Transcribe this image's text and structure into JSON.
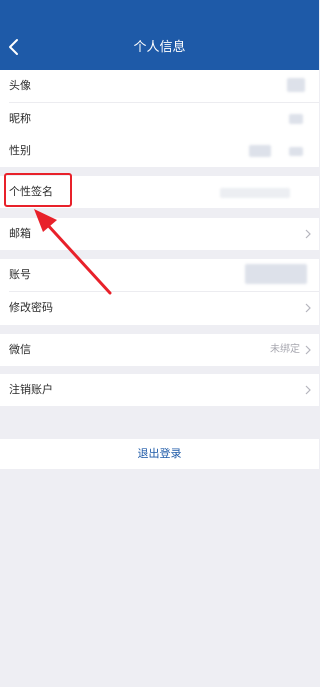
{
  "header": {
    "title": "个人信息",
    "back_icon": "chevron-left-icon",
    "background_color": "#1e5aa8"
  },
  "profile": {
    "avatar_label": "头像",
    "nickname_label": "昵称",
    "gender_label": "性别"
  },
  "signature": {
    "label": "个性签名"
  },
  "email": {
    "label": "邮箱",
    "chevron_icon": "chevron-right-icon"
  },
  "account": {
    "account_label": "账号",
    "change_password_label": "修改密码"
  },
  "wechat": {
    "label": "微信",
    "status": "未绑定"
  },
  "deactivate": {
    "label": "注销账户"
  },
  "logout": {
    "label": "退出登录"
  },
  "annotation": {
    "highlight_color": "#e8212a"
  }
}
